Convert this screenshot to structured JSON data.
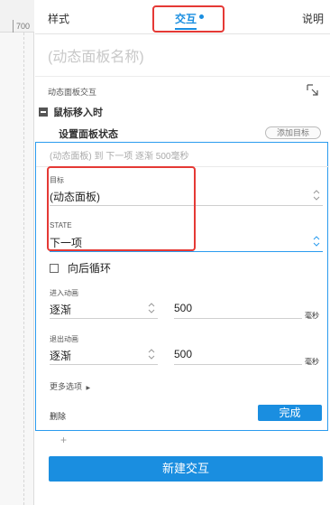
{
  "ruler": {
    "value": "700"
  },
  "tabs": [
    {
      "label": "样式"
    },
    {
      "label": "交互"
    },
    {
      "label": "说明"
    }
  ],
  "panel": {
    "name_placeholder": "(动态面板名称)",
    "section_title": "动态面板交互",
    "event": "鼠标移入时",
    "action": "设置面板状态",
    "add_target": "添加目标",
    "summary": "(动态面板) 到 下一项 逐渐 500毫秒",
    "target_label": "目标",
    "target_value": "(动态面板)",
    "state_label": "STATE",
    "state_value": "下一项",
    "loop_label": "向后循环",
    "enter_label": "进入动画",
    "enter_anim": "逐渐",
    "enter_duration": "500",
    "exit_label": "退出动画",
    "exit_anim": "逐渐",
    "exit_duration": "500",
    "unit": "毫秒",
    "more_options": "更多选项",
    "delete": "删除",
    "done": "完成"
  },
  "footer": {
    "plus": "+",
    "new_interaction": "新建交互"
  },
  "colors": {
    "accent": "#1a8ee0",
    "highlight": "#e53935"
  }
}
